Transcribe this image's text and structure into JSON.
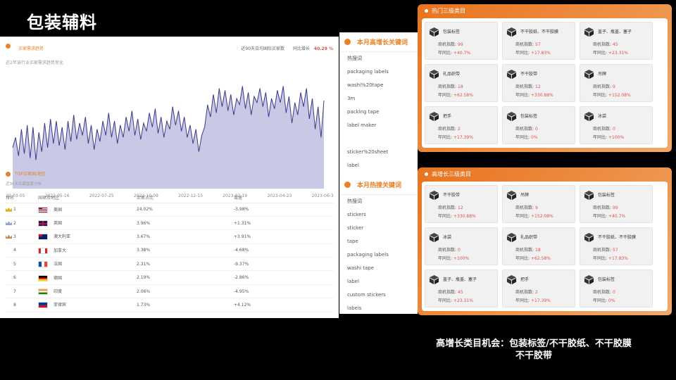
{
  "title": "包装辅料",
  "trend": {
    "title": "买家需求趋势",
    "subtitle": "近2年该行业买家需求趋势变化",
    "buyers_label": "近90天日均国际买家数",
    "yoy_label": "同比增长",
    "yoy_value": "40.29 %",
    "dates": [
      "2022-03-05",
      "2022-05-16",
      "2022-07-25",
      "2022-10-09",
      "2022-12-15",
      "2023-02-19",
      "2023-04-23",
      "2023-06-30"
    ]
  },
  "chart_data": {
    "type": "area",
    "x_range": [
      "2022-03-05",
      "2023-06-30"
    ],
    "series": [
      {
        "values": [
          40,
          50,
          32,
          58,
          34,
          62,
          30,
          60,
          28,
          55,
          36,
          64,
          40,
          68,
          44,
          66,
          42,
          60,
          38,
          66,
          46,
          72,
          48,
          64,
          52,
          70,
          44,
          62,
          38,
          58,
          46,
          66,
          52,
          74,
          50,
          66,
          44,
          62,
          50,
          70,
          56,
          76,
          52,
          68,
          48,
          64,
          56,
          74,
          60,
          78,
          54,
          70,
          50,
          66,
          58,
          80,
          62,
          76,
          56,
          70,
          50,
          62,
          44,
          58,
          36,
          52,
          60,
          82,
          70,
          92,
          74,
          98,
          80,
          96,
          76,
          92,
          72,
          88,
          82,
          100,
          78,
          94,
          72,
          90,
          84,
          98,
          80,
          94,
          70,
          88,
          78,
          96,
          84,
          100,
          74,
          90,
          64,
          84,
          72,
          94,
          80,
          98,
          68,
          88,
          58,
          80,
          50,
          86
        ]
      }
    ]
  },
  "top": {
    "title": "TOP买家国/地区",
    "subtitle": "近30天买家国家分布",
    "columns": [
      "排名",
      "国家及地区",
      "买家占比",
      "增速"
    ],
    "rows": [
      {
        "rank": "1",
        "country": "美国",
        "share": "24.02%",
        "growth": "-3.98%"
      },
      {
        "rank": "2",
        "country": "英国",
        "share": "3.96%",
        "growth": "+1.31%"
      },
      {
        "rank": "3",
        "country": "澳大利亚",
        "share": "3.67%",
        "growth": "+3.91%"
      },
      {
        "rank": "4",
        "country": "加拿大",
        "share": "3.38%",
        "growth": "-4.68%"
      },
      {
        "rank": "5",
        "country": "法国",
        "share": "2.31%",
        "growth": "-9.37%"
      },
      {
        "rank": "6",
        "country": "德国",
        "share": "2.19%",
        "growth": "-2.86%"
      },
      {
        "rank": "7",
        "country": "印度",
        "share": "2.06%",
        "growth": "-4.95%"
      },
      {
        "rank": "8",
        "country": "菲律宾",
        "share": "1.73%",
        "growth": "+4.12%"
      }
    ]
  },
  "growth_keywords": {
    "title": "本月高增长关键词",
    "items": [
      "热搜词",
      "packaging labels",
      "washi%20tape",
      "3m",
      "packing tape",
      "label maker",
      "",
      "sticker%20sheet",
      "label"
    ]
  },
  "hot_keywords": {
    "title": "本月热搜关键词",
    "items": [
      "热搜词",
      "stickers",
      "sticker",
      "tape",
      "packaging labels",
      "washi tape",
      "label",
      "custom stickers",
      "labels"
    ]
  },
  "hot_categories": {
    "title": "热门三级类目",
    "metric1": "商机指数:",
    "metric2": "年同比:",
    "cards": [
      {
        "name": "包装标签",
        "index": "99",
        "yoy": "+40.7%"
      },
      {
        "name": "不干胶纸、不干胶膜",
        "index": "57",
        "yoy": "+17.83%"
      },
      {
        "name": "盖子、瓶盖、塞子",
        "index": "45",
        "yoy": "+23.31%"
      },
      {
        "name": "礼品织带",
        "index": "18",
        "yoy": "+62.58%"
      },
      {
        "name": "不干胶带",
        "index": "12",
        "yoy": "+330.88%"
      },
      {
        "name": "吊牌",
        "index": "9",
        "yoy": "+152.08%"
      },
      {
        "name": "把手",
        "index": "2",
        "yoy": "+17.39%"
      },
      {
        "name": "包装标签",
        "index": "0",
        "yoy": "0%"
      },
      {
        "name": "冰袋",
        "index": "0",
        "yoy": "+100%"
      }
    ]
  },
  "growth_categories": {
    "title": "高增长三级类目",
    "metric1": "商机指数:",
    "metric2": "年同比:",
    "cards": [
      {
        "name": "不干胶带",
        "index": "12",
        "yoy": "+330.88%"
      },
      {
        "name": "吊牌",
        "index": "9",
        "yoy": "+152.08%"
      },
      {
        "name": "包装标签",
        "index": "99",
        "yoy": "+40.7%"
      },
      {
        "name": "冰袋",
        "index": "0",
        "yoy": "+100%"
      },
      {
        "name": "礼品织带",
        "index": "18",
        "yoy": "+62.58%"
      },
      {
        "name": "不干胶纸、不干胶膜",
        "index": "57",
        "yoy": "+17.83%"
      },
      {
        "name": "盖子、瓶盖、塞子",
        "index": "45",
        "yoy": "+23.31%"
      },
      {
        "name": "把手",
        "index": "2",
        "yoy": "+17.39%"
      },
      {
        "name": "包装标签",
        "index": "0",
        "yoy": "0%"
      }
    ]
  },
  "footer": {
    "line1": "高增长类目机会：包装标签/不干胶纸、不干胶膜",
    "line2": "不干胶带"
  }
}
